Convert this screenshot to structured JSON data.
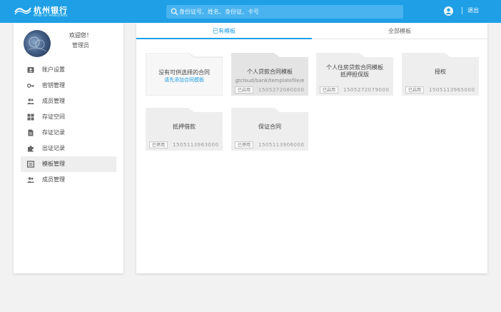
{
  "header": {
    "logo_text": "杭州银行",
    "logo_sub": "BANK OF HANGZHOU",
    "search_placeholder": "身份证号、姓名、身份证、卡号",
    "logout_label": "退出"
  },
  "profile": {
    "name": "欢迎您！",
    "subtitle": "管理员"
  },
  "sidebar": {
    "items": [
      {
        "label": "账户设置",
        "icon": "contact-card-icon",
        "active": false
      },
      {
        "label": "密钥管理",
        "icon": "key-icon",
        "active": false
      },
      {
        "label": "成员管理",
        "icon": "people-icon",
        "active": false
      },
      {
        "label": "存证空间",
        "icon": "grid-icon",
        "active": false
      },
      {
        "label": "存证记录",
        "icon": "document-icon",
        "active": false
      },
      {
        "label": "出证记录",
        "icon": "puzzle-icon",
        "active": false
      },
      {
        "label": "模板管理",
        "icon": "template-icon",
        "active": true
      },
      {
        "label": "成员管理",
        "icon": "group-icon",
        "active": false
      }
    ]
  },
  "tabs": [
    {
      "label": "已有模板",
      "active": true
    },
    {
      "label": "全部模板",
      "active": false
    }
  ],
  "cards": [
    {
      "title": "没有可供选择的合同",
      "subtitle": "请先添加合同模板",
      "badge": "",
      "number": ""
    },
    {
      "title": "个人贷款合同模板",
      "subtitle": "gtcloud/bank/templatefile/e",
      "badge": "已启用",
      "number": "1505272080000"
    },
    {
      "title": "个人住房贷款合同模板 抵押担保版",
      "subtitle": "",
      "badge": "已启用",
      "number": "1505272079000"
    },
    {
      "title": "授权",
      "subtitle": "",
      "badge": "已启用",
      "number": "1505113965000"
    },
    {
      "title": "抵押借款",
      "subtitle": "",
      "badge": "已停用",
      "number": "1505113963000"
    },
    {
      "title": "保证合同",
      "subtitle": "",
      "badge": "已停用",
      "number": "1505113906000"
    }
  ],
  "colors": {
    "primary": "#1e9fe6",
    "card_bg": "#eeeeee",
    "card_dark": "#e2e2e2"
  }
}
